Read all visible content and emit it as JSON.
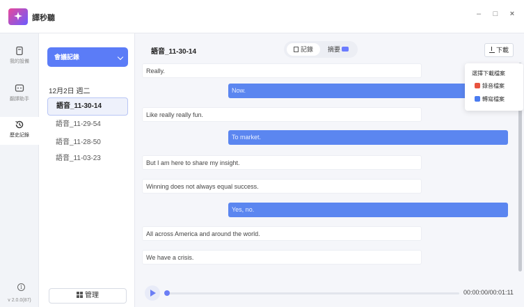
{
  "window": {
    "app_title": "譯秒聽",
    "minimize": "–",
    "maximize": "□",
    "close": "×"
  },
  "rail": {
    "items": [
      {
        "label": "我的設備",
        "icon": "device-icon"
      },
      {
        "label": "翻譯助手",
        "icon": "translate-assistant-icon"
      },
      {
        "label": "歷史記錄",
        "icon": "history-icon"
      }
    ],
    "active_index": 2,
    "version": "v 2.0.0(87)"
  },
  "list_panel": {
    "dropdown_label": "會議記錄",
    "date": "12月2日 週二",
    "records": [
      "語音_11-30-14",
      "語音_11-29-54",
      "語音_11-28-50",
      "語音_11-03-23"
    ],
    "selected_index": 0,
    "manage_label": "管理"
  },
  "main": {
    "title": "語音_11-30-14",
    "tabs": {
      "record": "記錄",
      "summary": "摘要"
    },
    "download_label": "下載",
    "download_menu": {
      "title": "選擇下載檔案",
      "audio": "錄音檔案",
      "transcript": "轉寫檔案"
    },
    "messages": [
      {
        "side": "left",
        "text": "Really."
      },
      {
        "side": "right",
        "text": "Now."
      },
      {
        "side": "left",
        "text": "Like really really fun."
      },
      {
        "side": "right",
        "text": "To market."
      },
      {
        "side": "left",
        "text": "But I am here to share my insight."
      },
      {
        "side": "left",
        "text": "Winning does not always equal success."
      },
      {
        "side": "right",
        "text": "Yes, no."
      },
      {
        "side": "left",
        "text": "All across America and around the world."
      },
      {
        "side": "left",
        "text": "We have a crisis."
      }
    ],
    "player": {
      "time": "00:00:00/00:01:11",
      "progress": 0
    }
  },
  "colors": {
    "accent": "#5b7cf7",
    "bubble_right": "#5b86f0",
    "audio_file": "#e8533f",
    "transcript_file": "#4a7cf0"
  }
}
